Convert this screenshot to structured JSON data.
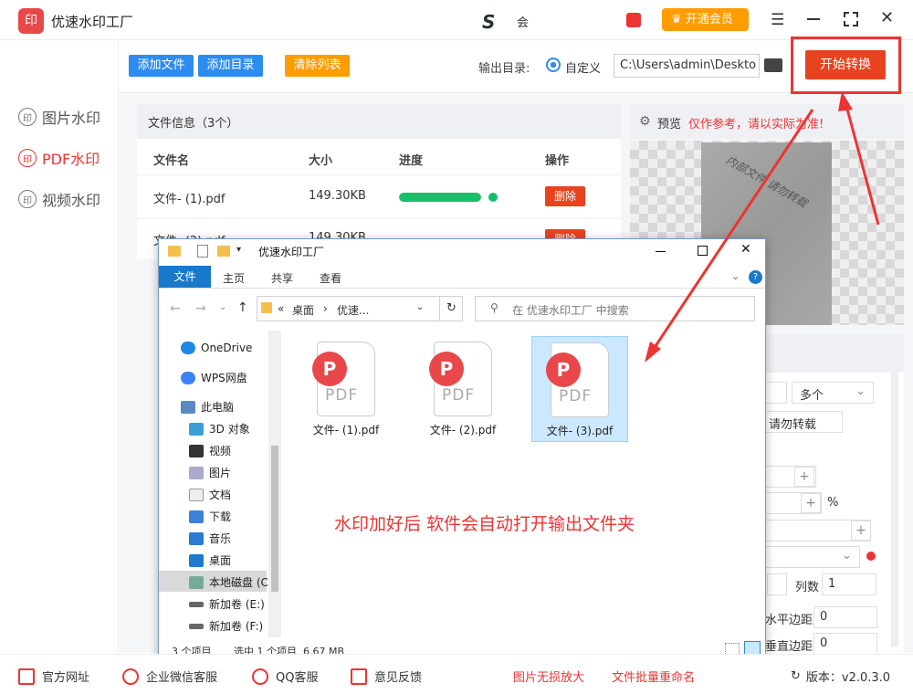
{
  "app": {
    "title": "优速水印工厂",
    "user": "会",
    "vip": "开通会员",
    "start": "开始转换"
  },
  "toolbar": {
    "add_file": "添加文件",
    "add_dir": "添加目录",
    "clear": "清除列表",
    "output_label": "输出目录:",
    "output_option": "自定义",
    "output_path": "C:\\Users\\admin\\Deskto"
  },
  "sidebar": {
    "items": [
      {
        "label": "图片水印"
      },
      {
        "label": "PDF水印"
      },
      {
        "label": "视频水印"
      }
    ]
  },
  "file_panel": {
    "title": "文件信息（3个）",
    "headers": [
      "文件名",
      "大小",
      "进度",
      "操作"
    ],
    "rows": [
      {
        "name": "文件- (1).pdf",
        "size": "149.30KB",
        "progress": 1.0,
        "action": "删除"
      }
    ],
    "row2_hint": "文件- (2).pdf",
    "row2_size": "149.30KB",
    "delete": "删除"
  },
  "preview": {
    "label": "预览",
    "note": "仅作参考，请以实际为准!",
    "watermark": "内部文件 请勿转载"
  },
  "settings": {
    "select2": "多个",
    "text_input": "请勿转载",
    "percent": "%",
    "cols_label": "列数",
    "cols_value": "1",
    "hmargin_label": "水平边距",
    "hmargin_value": "0",
    "vmargin_label": "垂直边距",
    "vmargin_value": "0"
  },
  "explorer": {
    "title": "优速水印工厂",
    "ribbon_tabs": [
      "文件",
      "主页",
      "共享",
      "查看"
    ],
    "path": [
      "桌面",
      "优速..."
    ],
    "path_prefix": "«",
    "search_placeholder": "在 优速水印工厂 中搜索",
    "nav": [
      {
        "label": "OneDrive"
      },
      {
        "label": "WPS网盘"
      },
      {
        "label": "此电脑"
      },
      {
        "label": "3D 对象"
      },
      {
        "label": "视频"
      },
      {
        "label": "图片"
      },
      {
        "label": "文档"
      },
      {
        "label": "下载"
      },
      {
        "label": "音乐"
      },
      {
        "label": "桌面"
      },
      {
        "label": "本地磁盘 (C:"
      },
      {
        "label": "新加卷 (E:)"
      },
      {
        "label": "新加卷 (F:)"
      }
    ],
    "files": [
      {
        "name": "文件- (1).pdf"
      },
      {
        "name": "文件- (2).pdf"
      },
      {
        "name": "文件- (3).pdf"
      }
    ],
    "status_count": "3 个项目",
    "status_selected": "选中 1 个项目  6.67 MB"
  },
  "annotation": "水印加好后 软件会自动打开输出文件夹",
  "footer": {
    "items": [
      "官方网址",
      "企业微信客服",
      "QQ客服",
      "意见反馈"
    ],
    "links": [
      "图片无损放大",
      "文件批量重命名"
    ],
    "version": "版本：v2.0.3.0"
  },
  "colors": {
    "accent": "#2d8cf0",
    "danger": "#e8431f",
    "progress": "#19be6b",
    "arrow": "#e33"
  }
}
